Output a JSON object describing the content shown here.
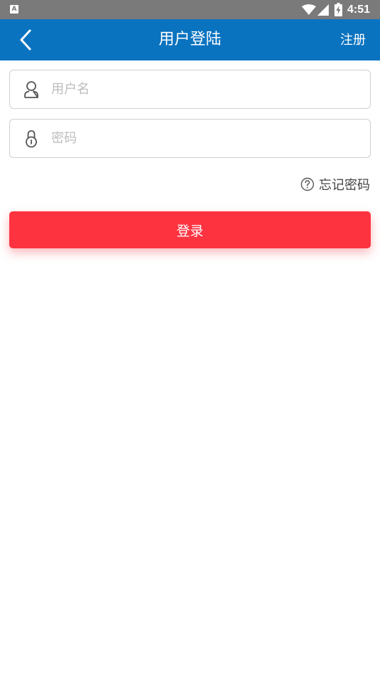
{
  "status_bar": {
    "app_icon_letter": "A",
    "time": "4:51"
  },
  "header": {
    "title": "用户登陆",
    "register_label": "注册"
  },
  "form": {
    "username_placeholder": "用户名",
    "username_value": "",
    "password_placeholder": "密码",
    "password_value": "",
    "forgot_label": "忘记密码",
    "login_label": "登录"
  },
  "icons": {
    "back": "chevron-left-icon",
    "username": "user-icon",
    "password": "lock-icon",
    "forgot": "question-circle-icon",
    "wifi": "wifi-icon",
    "signal": "signal-icon",
    "battery": "battery-charging-icon"
  },
  "colors": {
    "header": "#0a73c0",
    "status_bar": "#7a7a7a",
    "login_button": "#fd3340",
    "field_border": "#cfcfcf",
    "placeholder": "#bdbdbd"
  }
}
